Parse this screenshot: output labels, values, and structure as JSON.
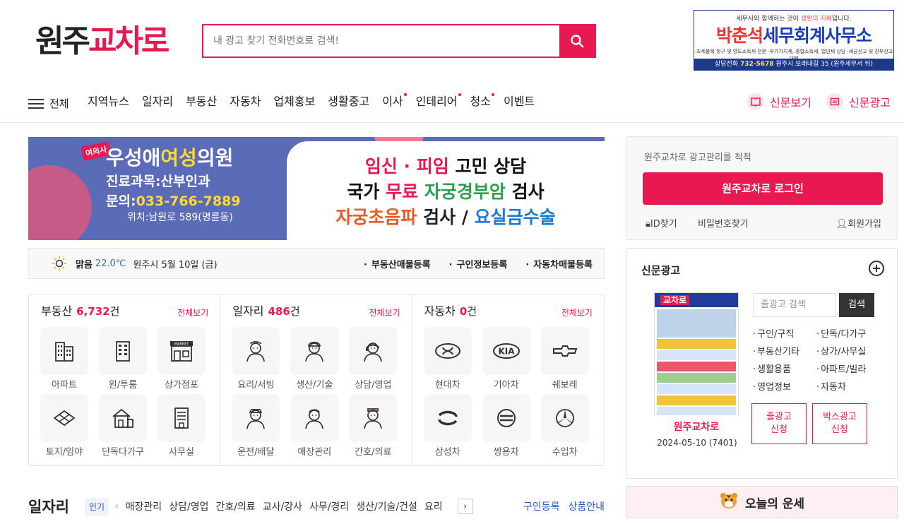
{
  "logo": {
    "part1": "원주",
    "part2": "교차로"
  },
  "search": {
    "placeholder": "내 광고 찾기 전화번호로 검색!"
  },
  "top_ad": {
    "line1_a": "세무사와 함께하는 것이 ",
    "line1_b": "생활의 지혜",
    "line1_c": "입니다.",
    "name_a": "박춘석",
    "name_b": "세무회계사무소",
    "services": "·조세불복 청구 및 양도소득세 전문  ·부가가치세, 종합소득세, 법인세 상담  ·세금신고 및 장부신고 대행",
    "phone_label": "상담전화",
    "phone": "732-5678",
    "address": "원주시 모래내길 35 (원주세무서 뒤)"
  },
  "nav": {
    "all_label": "전체",
    "items": [
      {
        "label": "지역뉴스",
        "dot": false
      },
      {
        "label": "일자리",
        "dot": false
      },
      {
        "label": "부동산",
        "dot": false
      },
      {
        "label": "자동차",
        "dot": false
      },
      {
        "label": "업체홍보",
        "dot": false
      },
      {
        "label": "생활중고",
        "dot": false
      },
      {
        "label": "이사",
        "dot": true
      },
      {
        "label": "인테리어",
        "dot": true
      },
      {
        "label": "청소",
        "dot": true
      },
      {
        "label": "이벤트",
        "dot": false
      }
    ],
    "newspaper_view": "신문보기",
    "newspaper_ad": "신문광고"
  },
  "banner": {
    "tag": "여의사",
    "clinic_a": "우성애",
    "clinic_b": "여성",
    "clinic_c": "의원",
    "dept": "진료과목:산부인과",
    "phone_label": "문의:",
    "phone": "033-766-7889",
    "location": "위치:남원로 589(명륜동)",
    "r1_a": "임신 · 피임",
    "r1_b": " 고민 상담",
    "r2_a": "국가 ",
    "r2_b": "무료",
    "r2_c": " ",
    "r2_d": "자궁경부암",
    "r2_e": " 검사",
    "r3_a": "자궁초음파",
    "r3_b": " 검사 / ",
    "r3_c": "요실금수술"
  },
  "weather": {
    "condition": "맑음",
    "temp": "22.0℃",
    "date": "원주시 5월 10일 (금)",
    "links": [
      "부동산매물등록",
      "구인정보등록",
      "자동차매물등록"
    ]
  },
  "categories": [
    {
      "title": "부동산",
      "count": "6,732",
      "unit": "건",
      "view_all": "전체보기",
      "items": [
        {
          "label": "아파트",
          "icon": "apartment-icon"
        },
        {
          "label": "원/투룸",
          "icon": "building-icon"
        },
        {
          "label": "상가점포",
          "icon": "store-icon"
        },
        {
          "label": "토지/임야",
          "icon": "land-icon"
        },
        {
          "label": "단독다가구",
          "icon": "house-icon"
        },
        {
          "label": "사무실",
          "icon": "office-icon"
        }
      ]
    },
    {
      "title": "일자리",
      "count": "486",
      "unit": "건",
      "view_all": "전체보기",
      "items": [
        {
          "label": "요리/서빙",
          "icon": "chef-icon"
        },
        {
          "label": "생산/기술",
          "icon": "worker-icon"
        },
        {
          "label": "상담/영업",
          "icon": "consultant-icon"
        },
        {
          "label": "운전/배달",
          "icon": "driver-icon"
        },
        {
          "label": "매장관리",
          "icon": "clerk-icon"
        },
        {
          "label": "간호/의료",
          "icon": "nurse-icon"
        }
      ]
    },
    {
      "title": "자동차",
      "count": "0",
      "unit": "건",
      "view_all": "전체보기",
      "items": [
        {
          "label": "현대차",
          "icon": "hyundai-icon"
        },
        {
          "label": "기아차",
          "icon": "kia-icon"
        },
        {
          "label": "쉐보레",
          "icon": "chevrolet-icon"
        },
        {
          "label": "삼성차",
          "icon": "samsung-icon"
        },
        {
          "label": "쌍용차",
          "icon": "ssangyong-icon"
        },
        {
          "label": "수입차",
          "icon": "import-car-icon"
        }
      ]
    }
  ],
  "jobs_bar": {
    "title": "일자리",
    "popular": "인기",
    "tags": [
      "매장관리",
      "상담/영업",
      "간호/의료",
      "교사/강사",
      "사무/경리",
      "생산/기술/건설",
      "요리"
    ],
    "register": "구인등록",
    "product_info": "상품안내"
  },
  "login": {
    "notice": "원주교차로 광고관리를 척척",
    "button": "원주교차로 로그인",
    "find_id": "ID찾기",
    "find_pw": "비밀번호찾기",
    "signup": "회원가입"
  },
  "paper": {
    "title": "신문광고",
    "cover_title": "교차로",
    "caption": "원주교차로",
    "date": "2024-05-10 (7401)",
    "search_placeholder": "줄광고 검색",
    "search_button": "검색",
    "links": [
      "구인/구직",
      "단독/다가구",
      "부동산기타",
      "상가/사무실",
      "생활용품",
      "아파트/빌라",
      "영업정보",
      "자동차"
    ],
    "line_ad": "줄광고\n신청",
    "box_ad": "박스광고\n신청"
  },
  "fortune": {
    "label": "오늘의 운세"
  },
  "colors": {
    "accent": "#e8194f",
    "navy": "#1d3a8a",
    "link_blue": "#2a55c4"
  }
}
